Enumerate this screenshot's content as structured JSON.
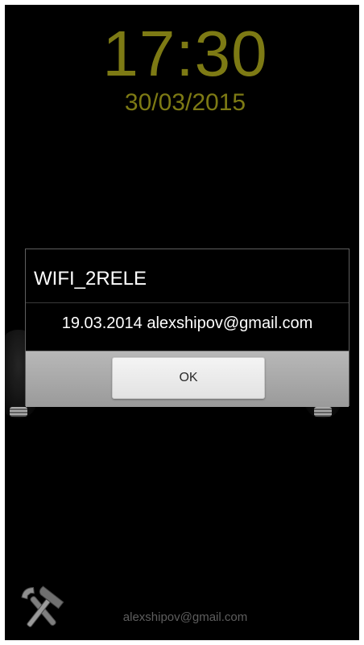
{
  "lockscreen": {
    "time": "17:30",
    "date": "30/03/2015",
    "accent_color": "#7d7a14"
  },
  "dialog": {
    "title": "WIFI_2RELE",
    "message": "19.03.2014 alexshipov@gmail.com",
    "ok_label": "OK"
  },
  "footer": {
    "settings_icon": "tools-icon",
    "email": "alexshipov@gmail.com"
  }
}
